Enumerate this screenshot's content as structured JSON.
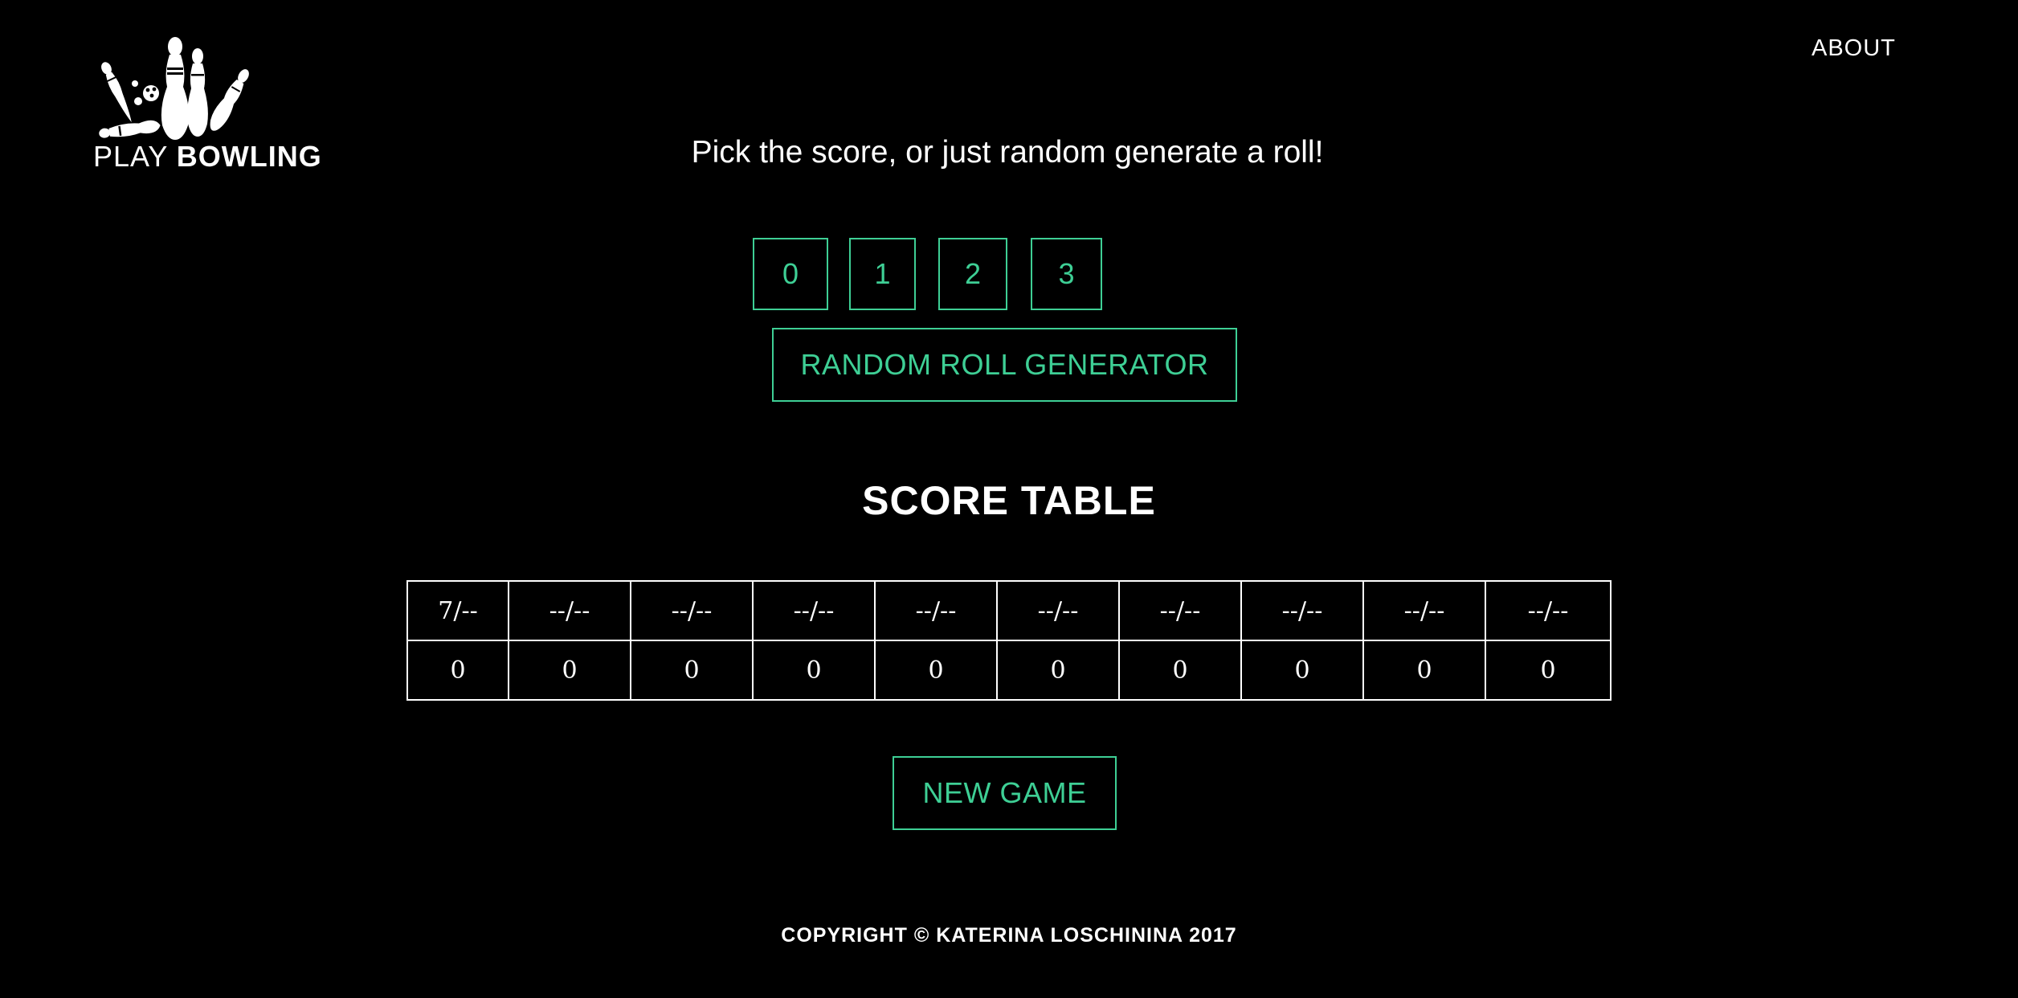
{
  "header": {
    "logo_text_light": "PLAY ",
    "logo_text_bold": "BOWLING",
    "logo_icon": "bowling-pins-icon",
    "about_label": "ABOUT"
  },
  "main": {
    "headline": "Pick the score, or just random generate a roll!",
    "score_buttons": [
      "0",
      "1",
      "2",
      "3"
    ],
    "random_button_label": "RANDOM ROLL GENERATOR",
    "table_title": "SCORE TABLE",
    "frames_row": [
      "7/--",
      "--/--",
      "--/--",
      "--/--",
      "--/--",
      "--/--",
      "--/--",
      "--/--",
      "--/--",
      "--/--"
    ],
    "totals_row": [
      "0",
      "0",
      "0",
      "0",
      "0",
      "0",
      "0",
      "0",
      "0",
      "0"
    ],
    "new_game_label": "NEW GAME"
  },
  "footer": {
    "copyright": "COPYRIGHT © KATERINA LOSCHININA 2017"
  },
  "colors": {
    "background": "#000000",
    "accent": "#3ecf95",
    "text": "#ffffff"
  }
}
